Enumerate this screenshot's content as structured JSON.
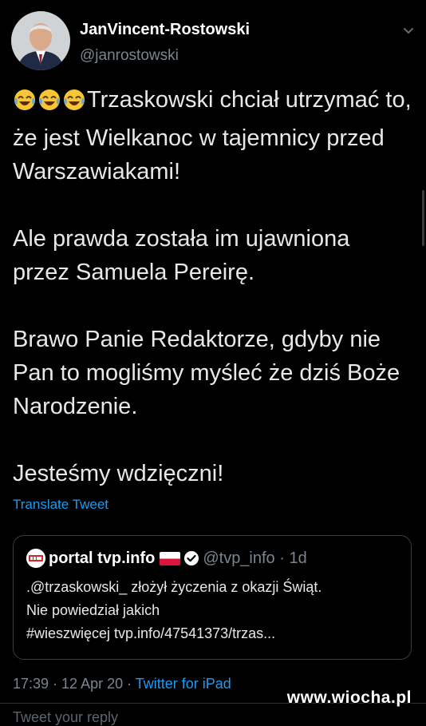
{
  "tweet": {
    "author": {
      "display_name": "JanVincent-Rostowski",
      "handle": "@janrostowski"
    },
    "paragraph_1_text": "Trzaskowski chciał utrzymać to, że jest Wielkanoc w tajemnicy przed Warszawiakami!",
    "paragraph_2": "Ale prawda została im ujawniona przez Samuela Pereirę.",
    "paragraph_3": "Brawo Panie Redaktorze, gdyby nie Pan to mogliśmy myśleć że dziś Boże Narodzenie.",
    "paragraph_4": "Jesteśmy wdzięczni!",
    "emoji_icon": "face-with-tears-of-joy-icon",
    "translate_label": "Translate Tweet",
    "timestamp": "17:39 · 12 Apr 20 · ",
    "source": "Twitter for iPad"
  },
  "quoted_tweet": {
    "display_name": "portal tvp.info",
    "handle_and_time": "@tvp_info · 1d",
    "text_line_1": ".@trzaskowski_ złożył życzenia z okazji Świąt.",
    "text_line_2": "Nie powiedział jakich",
    "text_line_3": "#wieszwięcej tvp.info/47541373/trzas..."
  },
  "reply_placeholder": "Tweet your reply",
  "watermark": "www.wiocha.pl",
  "colors": {
    "background": "#000000",
    "link_blue": "#1d9bf0",
    "muted_gray": "#7a8590",
    "text": "#e8e8e8"
  }
}
